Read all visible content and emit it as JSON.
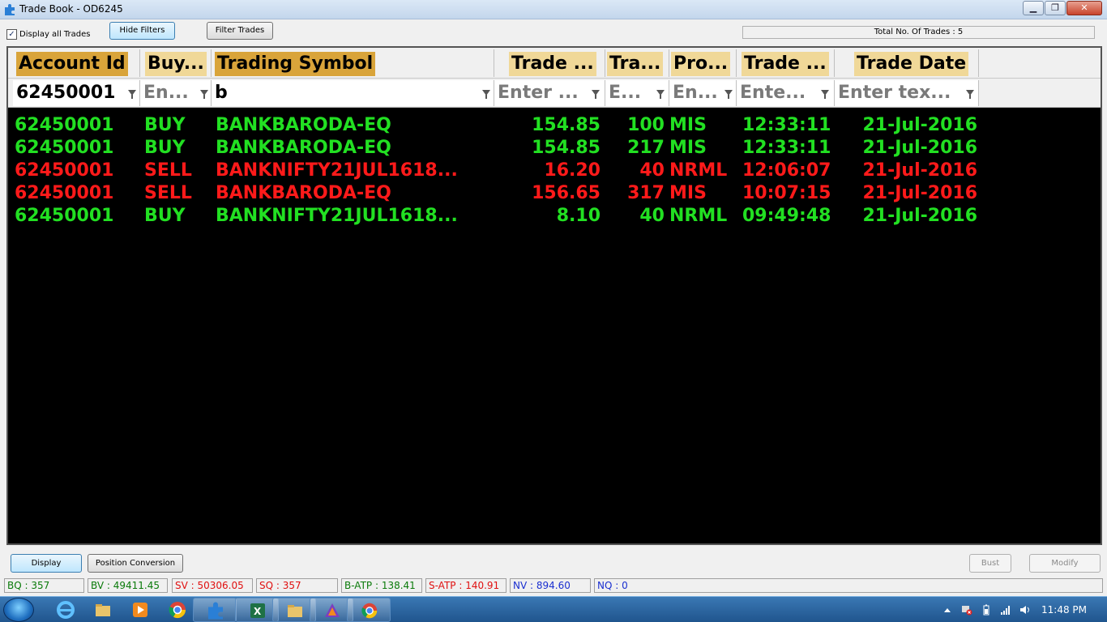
{
  "window": {
    "title": "Trade Book - OD6245"
  },
  "toolbar": {
    "display_all_label": "Display all Trades",
    "display_all_checked": "✓",
    "hide_filters_label": "Hide Filters",
    "filter_trades_label": "Filter Trades",
    "total_trades": "Total No. Of Trades : 5"
  },
  "grid": {
    "columns": [
      {
        "label": "Account Id",
        "filter": "62450001",
        "filled": true
      },
      {
        "label": "Buy...",
        "filter": "En...",
        "filled": false
      },
      {
        "label": "Trading Symbol",
        "filter": "b",
        "filled": true
      },
      {
        "label": "Trade ...",
        "filter": "Enter ...",
        "filled": false
      },
      {
        "label": "Tra...",
        "filter": "E...",
        "filled": false
      },
      {
        "label": "Pro...",
        "filter": "En...",
        "filled": false
      },
      {
        "label": "Trade ...",
        "filter": "Ente...",
        "filled": false
      },
      {
        "label": "Trade Date",
        "filter": "Enter tex...",
        "filled": false
      }
    ],
    "rows": [
      {
        "side": "buy",
        "cells": [
          "62450001",
          "BUY",
          "BANKBARODA-EQ",
          "154.85",
          "100",
          "MIS",
          "12:33:11",
          "21-Jul-2016"
        ]
      },
      {
        "side": "buy",
        "cells": [
          "62450001",
          "BUY",
          "BANKBARODA-EQ",
          "154.85",
          "217",
          "MIS",
          "12:33:11",
          "21-Jul-2016"
        ]
      },
      {
        "side": "sell",
        "cells": [
          "62450001",
          "SELL",
          "BANKNIFTY21JUL1618...",
          "16.20",
          "40",
          "NRML",
          "12:06:07",
          "21-Jul-2016"
        ]
      },
      {
        "side": "sell",
        "cells": [
          "62450001",
          "SELL",
          "BANKBARODA-EQ",
          "156.65",
          "317",
          "MIS",
          "10:07:15",
          "21-Jul-2016"
        ]
      },
      {
        "side": "buy",
        "cells": [
          "62450001",
          "BUY",
          "BANKNIFTY21JUL1618...",
          "8.10",
          "40",
          "NRML",
          "09:49:48",
          "21-Jul-2016"
        ]
      }
    ]
  },
  "bottom": {
    "display_label": "Display",
    "position_conversion_label": "Position Conversion",
    "bust_label": "Bust",
    "modify_label": "Modify"
  },
  "status": [
    {
      "text": "BQ : 357",
      "color": "#0a7a0a"
    },
    {
      "text": "BV : 49411.45",
      "color": "#0a7a0a"
    },
    {
      "text": "SV : 50306.05",
      "color": "#e01010"
    },
    {
      "text": "SQ : 357",
      "color": "#e01010"
    },
    {
      "text": "B-ATP : 138.41",
      "color": "#0a7a0a"
    },
    {
      "text": "S-ATP : 140.91",
      "color": "#e01010"
    },
    {
      "text": "NV : 894.60",
      "color": "#1a2fd0"
    },
    {
      "text": "NQ : 0",
      "color": "#1a2fd0"
    }
  ],
  "taskbar": {
    "clock": "11:48 PM"
  },
  "colors": {
    "buy": "#22e022",
    "sell": "#ff1a1a",
    "header_active": "#d9a43a",
    "header": "#f0d898"
  },
  "icons": [
    "app-puzzle-icon",
    "ie-icon",
    "explorer-folder-icon",
    "media-player-icon",
    "chrome-icon",
    "puzzle-app-icon",
    "excel-icon",
    "folder-icon",
    "prism-icon",
    "chrome-red-icon"
  ]
}
